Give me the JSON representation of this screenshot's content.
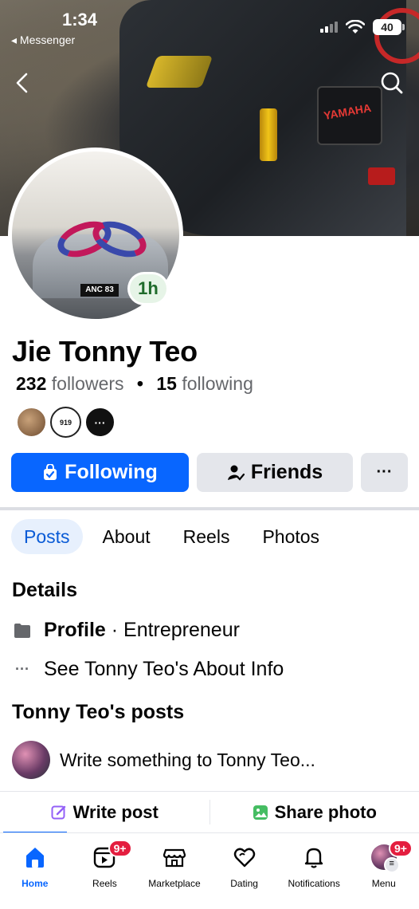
{
  "status_bar": {
    "time": "1:34",
    "back_app": "◂ Messenger",
    "battery": "40"
  },
  "cover": {
    "plate_text": "YAMAHA"
  },
  "avatar": {
    "plate_text": "ANC 83",
    "story_time": "1h"
  },
  "profile": {
    "name": "Jie Tonny Teo",
    "followers_count": "232",
    "followers_label": "followers",
    "following_count": "15",
    "following_label": "following",
    "mutual_2_text": "919",
    "mutual_3_text": "···"
  },
  "actions": {
    "following_label": "Following",
    "friends_label": "Friends",
    "more_label": "···"
  },
  "tabs": [
    {
      "label": "Posts",
      "active": true
    },
    {
      "label": "About",
      "active": false
    },
    {
      "label": "Reels",
      "active": false
    },
    {
      "label": "Photos",
      "active": false
    }
  ],
  "details": {
    "title": "Details",
    "profile_label": "Profile",
    "profile_sep": " · ",
    "profile_category": "Entrepreneur",
    "about_link": "See Tonny Teo's About Info"
  },
  "posts": {
    "title": "Tonny Teo's posts",
    "composer_placeholder": "Write something to Tonny Teo...",
    "write_post_label": "Write post",
    "share_photo_label": "Share photo"
  },
  "bottom_nav": {
    "items": [
      {
        "label": "Home",
        "icon": "home-icon",
        "badge": ""
      },
      {
        "label": "Reels",
        "icon": "reels-icon",
        "badge": "9+"
      },
      {
        "label": "Marketplace",
        "icon": "marketplace-icon",
        "badge": ""
      },
      {
        "label": "Dating",
        "icon": "dating-icon",
        "badge": ""
      },
      {
        "label": "Notifications",
        "icon": "bell-icon",
        "badge": ""
      },
      {
        "label": "Menu",
        "icon": "menu-avatar-icon",
        "badge": "9+"
      }
    ]
  },
  "colors": {
    "accent": "#0866ff",
    "tab_active_bg": "#e7f0fd",
    "badge": "#e41e3f",
    "button_gray": "#e4e6eb"
  }
}
